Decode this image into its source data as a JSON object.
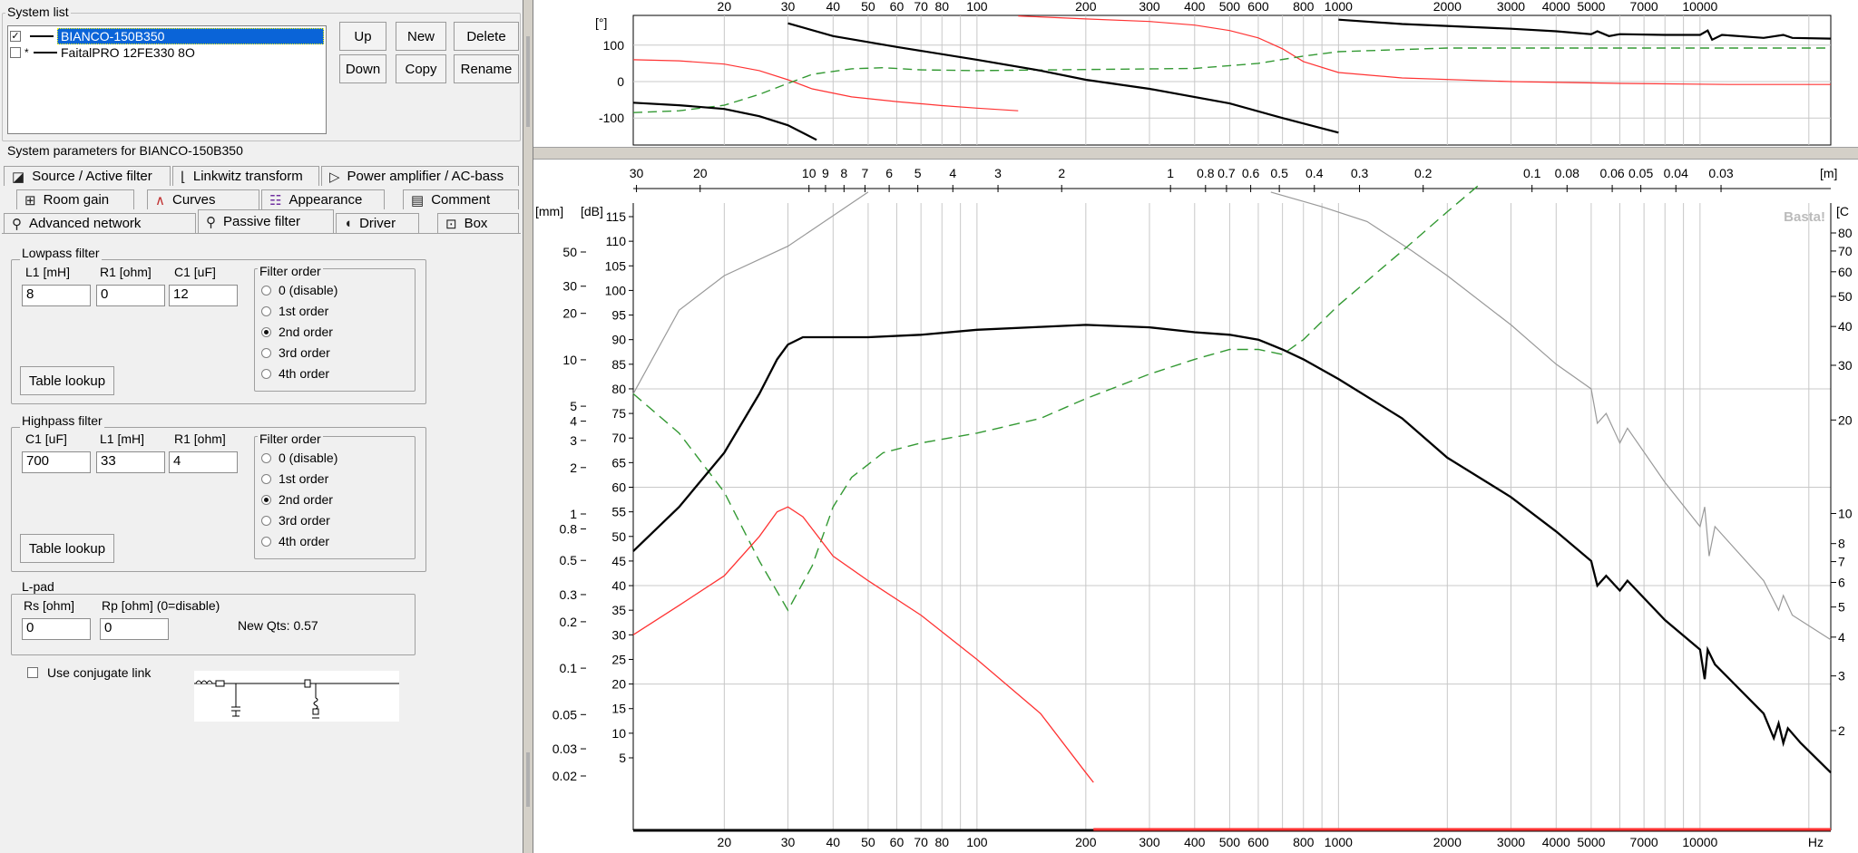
{
  "system_list": {
    "title": "System list",
    "items": [
      {
        "name": "BIANCO-150B350",
        "checked": true,
        "selected": true,
        "marker": ""
      },
      {
        "name": "FaitalPRO 12FE330 8O",
        "checked": false,
        "selected": false,
        "marker": "*"
      }
    ],
    "buttons": {
      "up": "Up",
      "new": "New",
      "delete": "Delete",
      "down": "Down",
      "copy": "Copy",
      "rename": "Rename"
    }
  },
  "params_title": "System parameters for BIANCO-150B350",
  "tabs": {
    "row1": [
      {
        "label": "Source / Active filter",
        "icon": "source-icon"
      },
      {
        "label": "Linkwitz transform",
        "icon": "linkwitz-icon"
      },
      {
        "label": "Power amplifier / AC-bass",
        "icon": "amplifier-icon"
      }
    ],
    "row2": [
      {
        "label": "Room gain",
        "icon": "room-gain-icon"
      },
      {
        "label": "Curves",
        "icon": "curves-icon"
      },
      {
        "label": "Appearance",
        "icon": "appearance-icon"
      },
      {
        "label": "Comment",
        "icon": "comment-icon"
      }
    ],
    "row3": [
      {
        "label": "Advanced network",
        "icon": "network-icon"
      },
      {
        "label": "Passive filter",
        "icon": "filter-icon",
        "active": true
      },
      {
        "label": "Driver",
        "icon": "driver-icon"
      },
      {
        "label": "Box",
        "icon": "box-icon"
      }
    ]
  },
  "lowpass": {
    "title": "Lowpass filter",
    "labels": [
      "L1 [mH]",
      "R1 [ohm]",
      "C1 [uF]"
    ],
    "values": [
      "8",
      "0",
      "12"
    ],
    "order_title": "Filter order",
    "orders": [
      "0 (disable)",
      "1st order",
      "2nd order",
      "3rd order",
      "4th order"
    ],
    "selected_order": 2,
    "table_lookup": "Table lookup"
  },
  "highpass": {
    "title": "Highpass filter",
    "labels": [
      "C1 [uF]",
      "L1 [mH]",
      "R1 [ohm]"
    ],
    "values": [
      "700",
      "33",
      "4"
    ],
    "order_title": "Filter order",
    "orders": [
      "0 (disable)",
      "1st order",
      "2nd order",
      "3rd order",
      "4th order"
    ],
    "selected_order": 2,
    "table_lookup": "Table lookup"
  },
  "lpad": {
    "title": "L-pad",
    "rs_label": "Rs [ohm]",
    "rp_label": "Rp [ohm] (0=disable)",
    "rs_value": "0",
    "rp_value": "0",
    "new_qts": "New Qts: 0.57"
  },
  "conjugate": {
    "label": "Use conjugate link",
    "checked": false
  },
  "colors": {
    "spl": "#000000",
    "impedance": "#ff3333",
    "excursion": "#339933",
    "wavelength": "#999999",
    "grid": "#c8c8c8",
    "panel": "#f0f0f0",
    "selection": "#0a64d8"
  },
  "phase_chart": {
    "y_unit": "[°]",
    "y_ticks": [
      "100",
      "0",
      "-100"
    ],
    "freq_ticks": [
      "20",
      "30",
      "40",
      "50",
      "60",
      "70",
      "80",
      "100",
      "200",
      "300",
      "400",
      "500",
      "600",
      "800",
      "1000",
      "2000",
      "3000",
      "4000",
      "5000",
      "7000",
      "10000"
    ]
  },
  "main_chart": {
    "wavelength_unit": "[m]",
    "wavelength_ticks": [
      "30",
      "20",
      "10",
      "9",
      "8",
      "7",
      "6",
      "5",
      "4",
      "3",
      "2",
      "1",
      "0.8",
      "0.7",
      "0.6",
      "0.5",
      "0.4",
      "0.3",
      "0.2",
      "0.1",
      "0.08",
      "0.06",
      "0.05",
      "0.04",
      "0.03"
    ],
    "mm_unit": "[mm]",
    "mm_ticks": [
      "50",
      "30",
      "20",
      "10",
      "5",
      "4",
      "3",
      "2",
      "1",
      "0.8",
      "0.5",
      "0.3",
      "0.2",
      "0.1",
      "0.05",
      "0.03",
      "0.02"
    ],
    "db_unit": "[dB]",
    "db_ticks": [
      "115",
      "110",
      "105",
      "100",
      "95",
      "90",
      "85",
      "80",
      "75",
      "70",
      "65",
      "60",
      "55",
      "50",
      "45",
      "40",
      "35",
      "30",
      "25",
      "20",
      "15",
      "10",
      "5"
    ],
    "right_unit": "[C",
    "right_ticks": [
      "80",
      "70",
      "60",
      "50",
      "40",
      "30",
      "20",
      "10",
      "8",
      "7",
      "6",
      "5",
      "4",
      "3",
      "2"
    ],
    "freq_ticks": [
      "20",
      "30",
      "40",
      "50",
      "60",
      "70",
      "80",
      "100",
      "200",
      "300",
      "400",
      "500",
      "600",
      "800",
      "1000",
      "2000",
      "3000",
      "4000",
      "5000",
      "7000",
      "10000"
    ],
    "freq_unit": "Hz",
    "watermark": "Basta!"
  }
}
